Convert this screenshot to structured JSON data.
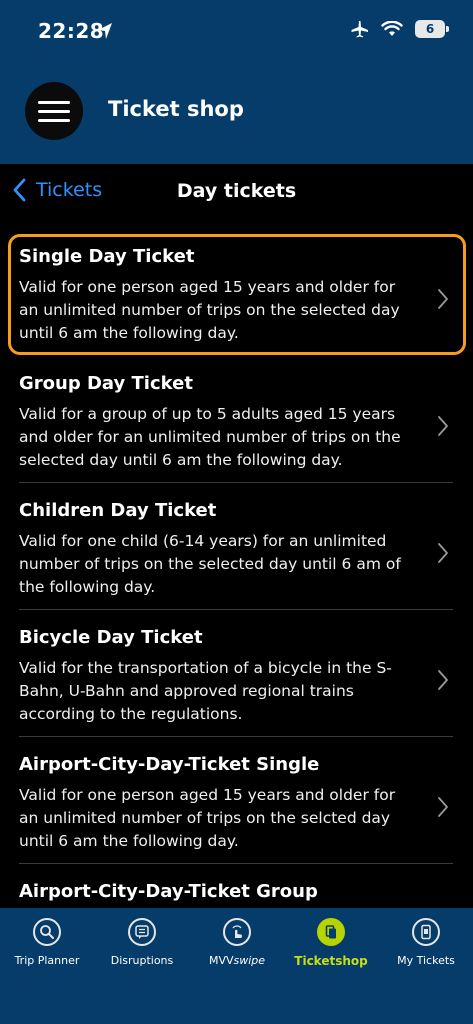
{
  "status_bar": {
    "time": "22:28",
    "battery": "6"
  },
  "header": {
    "title": "Ticket shop"
  },
  "nav": {
    "back_label": "Tickets",
    "title": "Day tickets"
  },
  "tickets": [
    {
      "title": "Single Day Ticket",
      "description": "Valid for one person aged 15 years and older for an unlimited number of trips on the selected day until 6 am the following day.",
      "focused": true
    },
    {
      "title": "Group Day Ticket",
      "description": "Valid for a group of up to 5 adults aged 15 years and older for an unlimited number of trips on the selected day until 6 am the following day."
    },
    {
      "title": "Children Day Ticket",
      "description": "Valid for one child (6-14 years) for an unlimited number of trips on the selected day until 6 am of the following day."
    },
    {
      "title": "Bicycle Day Ticket",
      "description": "Valid for the transportation of a bicycle in the S-Bahn, U-Bahn and approved regional trains according to the regulations."
    },
    {
      "title": "Airport-City-Day-Ticket Single",
      "description": "Valid for one person aged 15 years and older for an unlimited number of trips on the selcted day until 6 am the following day."
    },
    {
      "title": "Airport-City-Day-Ticket Group",
      "description": ""
    }
  ],
  "tab_bar": {
    "tabs": [
      {
        "label": "Trip Planner",
        "icon": "search-icon"
      },
      {
        "label": "Disruptions",
        "icon": "message-icon"
      },
      {
        "label_prefix": "MVV",
        "label_suffix": "swipe",
        "icon": "swipe-icon"
      },
      {
        "label": "Ticketshop",
        "icon": "ticket-icon",
        "active": true
      },
      {
        "label": "My Tickets",
        "icon": "phone-ticket-icon"
      }
    ]
  },
  "colors": {
    "header_blue": "#053c6a",
    "focus_orange": "#f89c1c",
    "link_blue": "#2f93ff",
    "active_green": "#b8d400"
  }
}
